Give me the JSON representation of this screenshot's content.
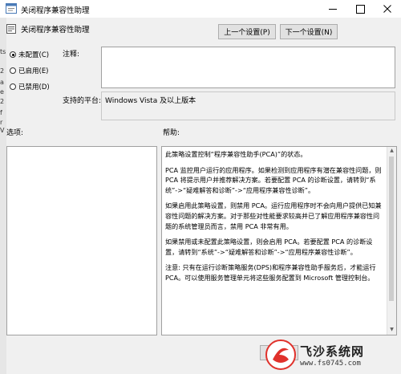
{
  "window": {
    "title": "关闭程序兼容性助理",
    "minimize": "—",
    "maximize": "☐",
    "close": "✕"
  },
  "left_strip": [
    "ts",
    "2",
    "a",
    "e",
    "2",
    "f",
    "r",
    "V"
  ],
  "policy": {
    "title": "关闭程序兼容性助理"
  },
  "nav": {
    "prev_label": "上一个设置(P)",
    "next_label": "下一个设置(N)"
  },
  "state": {
    "options": [
      {
        "label": "未配置(C)",
        "selected": true
      },
      {
        "label": "已启用(E)",
        "selected": false
      },
      {
        "label": "已禁用(D)",
        "selected": false
      }
    ]
  },
  "comment": {
    "label": "注释:",
    "value": ""
  },
  "platform": {
    "label": "支持的平台:",
    "value": "Windows Vista 及以上版本"
  },
  "options_label": "选项:",
  "help_label": "帮助:",
  "help_paragraphs": [
    "此策略设置控制“程序兼容性助手(PCA)”的状态。",
    "PCA 监控用户运行的应用程序。如果检测到应用程序有潜在兼容性问题，则 PCA 将提示用户并推荐解决方案。若要配置 PCA 的诊断设置，请转到“系统”->“疑难解答和诊断”->“应用程序兼容性诊断”。",
    "如果启用此策略设置，则禁用 PCA。运行应用程序时不会向用户提供已知兼容性问题的解决方案。对于那些对性能要求较高并已了解应用程序兼容性问题的系统管理员而言，禁用 PCA 非常有用。",
    "如果禁用或未配置此策略设置，则会启用 PCA。若要配置 PCA 的诊断设置，请转到“系统”->“疑难解答和诊断”->“应用程序兼容性诊断”。",
    "注意: 只有在运行诊断策略服务(DPS)和程序兼容性助手服务后，才能运行 PCA。可以使用服务管理单元将这些服务配置到 Microsoft 管理控制台。"
  ],
  "watermark": {
    "name": "飞沙系统网",
    "url": "www.fs0745.com"
  },
  "colors": {
    "accent": "#0078d7",
    "background": "#f0f0f0",
    "watermark_red": "#e0312b"
  }
}
